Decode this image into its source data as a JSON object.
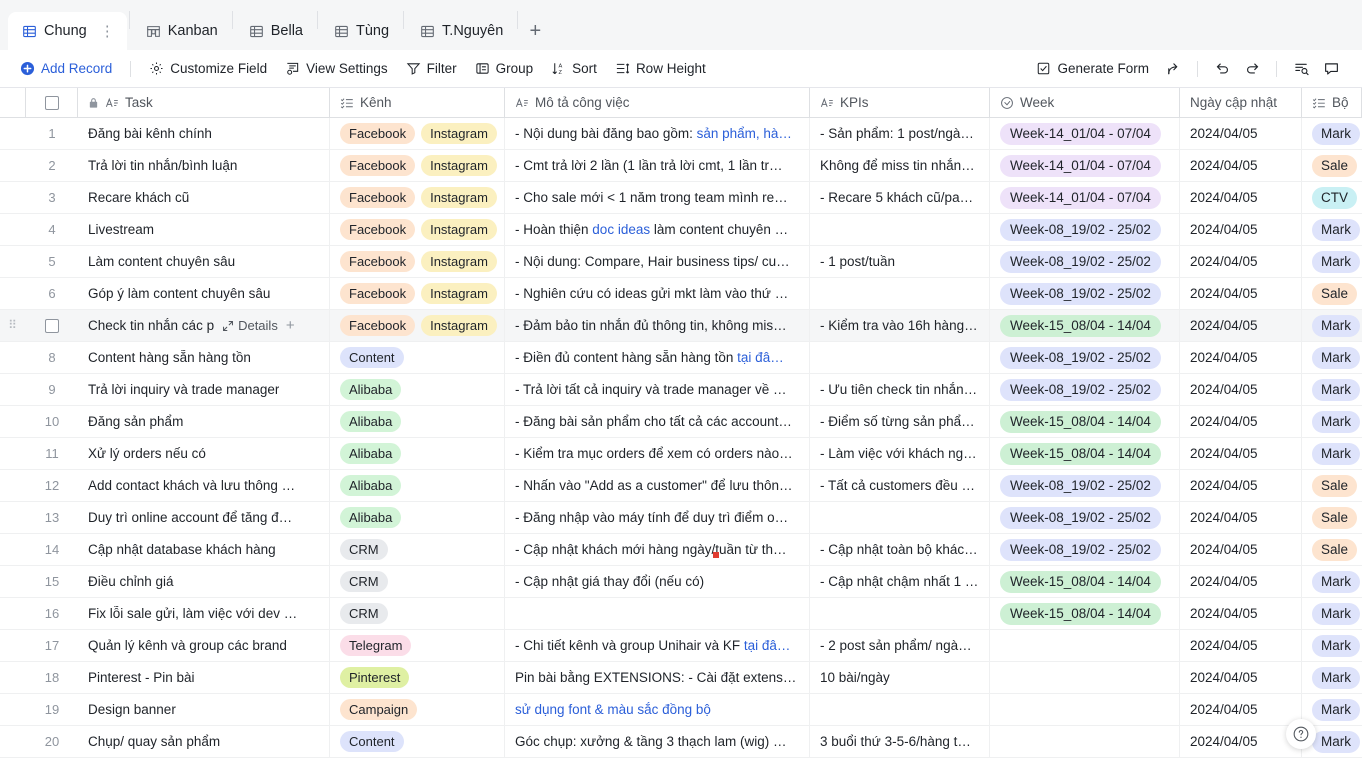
{
  "tabs": [
    {
      "label": "Chung",
      "icon": "grid-icon",
      "active": true
    },
    {
      "label": "Kanban",
      "icon": "kanban-icon",
      "active": false
    },
    {
      "label": "Bella",
      "icon": "grid-icon",
      "active": false
    },
    {
      "label": "Tùng",
      "icon": "grid-icon",
      "active": false
    },
    {
      "label": "T.Nguyên",
      "icon": "grid-icon",
      "active": false
    }
  ],
  "tab_add_label": "+",
  "tab_more_label": "⋮",
  "toolbar": {
    "add_record": "Add Record",
    "customize_field": "Customize Field",
    "view_settings": "View Settings",
    "filter": "Filter",
    "group": "Group",
    "sort": "Sort",
    "row_height": "Row Height",
    "generate_form": "Generate Form",
    "share_icon": "share-icon",
    "undo_icon": "undo-icon",
    "redo_icon": "redo-icon",
    "search_icon": "search-records-icon",
    "comment_icon": "comment-icon"
  },
  "columns": [
    {
      "key": "task",
      "label": "Task",
      "icon": "text-field-icon",
      "locked": true
    },
    {
      "key": "kenh",
      "label": "Kênh",
      "icon": "multi-select-icon"
    },
    {
      "key": "mota",
      "label": "Mô tả công việc",
      "icon": "text-field-icon"
    },
    {
      "key": "kpi",
      "label": "KPIs",
      "icon": "text-field-icon"
    },
    {
      "key": "week",
      "label": "Week",
      "icon": "single-select-icon"
    },
    {
      "key": "ngay",
      "label": "Ngày cập nhật",
      "icon": ""
    },
    {
      "key": "bo",
      "label": "Bộ",
      "icon": "multi-select-icon"
    }
  ],
  "help_label": "?",
  "rows": [
    {
      "num": "1",
      "task": "Đăng bài kênh chính",
      "kenh": [
        {
          "text": "Facebook",
          "style": "fb"
        },
        {
          "text": "Instagram",
          "style": "ig"
        }
      ],
      "mota_plain": "- Nội dung bài đăng bao gồm: ",
      "mota_link": "sản phẩm, hà…",
      "kpi": "- Sản phẩm: 1 post/ngà…",
      "week": "Week-14_01/04 - 07/04",
      "week_style": "purple",
      "ngay": "2024/04/05",
      "bo": "Mark",
      "bo_style": "mark"
    },
    {
      "num": "2",
      "task": "Trả lời tin nhắn/bình luận",
      "kenh": [
        {
          "text": "Facebook",
          "style": "fb"
        },
        {
          "text": "Instagram",
          "style": "ig"
        }
      ],
      "mota_plain": "- Cmt trả lời 2 lần (1 lần trả lời cmt, 1 lần tr…",
      "mota_link": "",
      "kpi": "Không để miss tin nhắn…",
      "week": "Week-14_01/04 - 07/04",
      "week_style": "purple",
      "ngay": "2024/04/05",
      "bo": "Sale",
      "bo_style": "sale"
    },
    {
      "num": "3",
      "task": "Recare khách cũ",
      "kenh": [
        {
          "text": "Facebook",
          "style": "fb"
        },
        {
          "text": "Instagram",
          "style": "ig"
        }
      ],
      "mota_plain": "- Cho sale mới < 1 năm trong team mình re…",
      "mota_link": "",
      "kpi": "- Recare 5 khách cũ/pag…",
      "week": "Week-14_01/04 - 07/04",
      "week_style": "purple",
      "ngay": "2024/04/05",
      "bo": "CTV",
      "bo_style": "ctv"
    },
    {
      "num": "4",
      "task": "Livestream",
      "kenh": [
        {
          "text": "Facebook",
          "style": "fb"
        },
        {
          "text": "Instagram",
          "style": "ig"
        }
      ],
      "mota_plain": "- Hoàn thiện ",
      "mota_link": "doc ideas",
      "mota_tail": " làm content chuyên …",
      "kpi": "",
      "week": "Week-08_19/02 - 25/02",
      "week_style": "blue",
      "ngay": "2024/04/05",
      "bo": "Mark",
      "bo_style": "mark"
    },
    {
      "num": "5",
      "task": "Làm content chuyên sâu",
      "kenh": [
        {
          "text": "Facebook",
          "style": "fb"
        },
        {
          "text": "Instagram",
          "style": "ig"
        }
      ],
      "mota_plain": "- Nội dung: Compare, Hair business tips/ cu…",
      "mota_link": "",
      "kpi": "- 1 post/tuần",
      "week": "Week-08_19/02 - 25/02",
      "week_style": "blue",
      "ngay": "2024/04/05",
      "bo": "Mark",
      "bo_style": "mark"
    },
    {
      "num": "6",
      "task": "Góp ý làm content chuyên sâu",
      "kenh": [
        {
          "text": "Facebook",
          "style": "fb"
        },
        {
          "text": "Instagram",
          "style": "ig"
        }
      ],
      "mota_plain": "- Nghiên cứu có ideas gửi mkt làm vào thứ …",
      "mota_link": "",
      "kpi": "",
      "week": "Week-08_19/02 - 25/02",
      "week_style": "blue",
      "ngay": "2024/04/05",
      "bo": "Sale",
      "bo_style": "sale"
    },
    {
      "num": "7",
      "task": "Check tin nhắn các p",
      "hovered": true,
      "details_label": "Details",
      "expand_icon": "expand-icon",
      "add_icon": "plus-icon",
      "kenh": [
        {
          "text": "Facebook",
          "style": "fb"
        },
        {
          "text": "Instagram",
          "style": "ig"
        }
      ],
      "mota_plain": "- Đảm bảo tin nhắn đủ thông tin, không mis…",
      "mota_link": "",
      "kpi": "- Kiểm tra vào 16h hàng…",
      "week": "Week-15_08/04 - 14/04",
      "week_style": "green",
      "ngay": "2024/04/05",
      "bo": "Mark",
      "bo_style": "mark"
    },
    {
      "num": "8",
      "task": "Content hàng sẵn hàng tồn",
      "kenh": [
        {
          "text": "Content",
          "style": "cont"
        }
      ],
      "mota_plain": "- Điền đủ content hàng sẵn hàng tồn ",
      "mota_link": "tại đâ…",
      "kpi": "",
      "week": "Week-08_19/02 - 25/02",
      "week_style": "blue",
      "ngay": "2024/04/05",
      "bo": "Mark",
      "bo_style": "mark"
    },
    {
      "num": "9",
      "task": "Trả lời inquiry và trade manager",
      "kenh": [
        {
          "text": "Alibaba",
          "style": "ali"
        }
      ],
      "mota_plain": "- Trả lời tất cả inquiry và trade manager về …",
      "mota_link": "",
      "kpi": "- Ưu tiên check tin nhắn…",
      "week": "Week-08_19/02 - 25/02",
      "week_style": "blue",
      "ngay": "2024/04/05",
      "bo": "Mark",
      "bo_style": "mark"
    },
    {
      "num": "10",
      "task": "Đăng sản phẩm",
      "kenh": [
        {
          "text": "Alibaba",
          "style": "ali"
        }
      ],
      "mota_plain": "- Đăng bài sản phẩm cho tất cả các account…",
      "mota_link": "",
      "kpi": "- Điểm số từng sản phẩ…",
      "week": "Week-15_08/04 - 14/04",
      "week_style": "green",
      "ngay": "2024/04/05",
      "bo": "Mark",
      "bo_style": "mark"
    },
    {
      "num": "11",
      "task": "Xử lý orders nếu có",
      "kenh": [
        {
          "text": "Alibaba",
          "style": "ali"
        }
      ],
      "mota_plain": "- Kiểm tra mục orders để xem có orders nào…",
      "mota_link": "",
      "kpi": "- Làm việc với khách ng…",
      "week": "Week-15_08/04 - 14/04",
      "week_style": "green",
      "ngay": "2024/04/05",
      "bo": "Mark",
      "bo_style": "mark"
    },
    {
      "num": "12",
      "task": "Add contact khách và lưu thông …",
      "kenh": [
        {
          "text": "Alibaba",
          "style": "ali"
        }
      ],
      "mota_plain": "- Nhấn vào \"Add as a customer\" để lưu thôn…",
      "mota_link": "",
      "kpi": "- Tất cả customers đều …",
      "week": "Week-08_19/02 - 25/02",
      "week_style": "blue",
      "ngay": "2024/04/05",
      "bo": "Sale",
      "bo_style": "sale"
    },
    {
      "num": "13",
      "task": "Duy trì online account để tăng đ…",
      "kenh": [
        {
          "text": "Alibaba",
          "style": "ali"
        }
      ],
      "mota_plain": "- Đăng nhập vào máy tính để duy trì điểm o…",
      "mota_link": "",
      "kpi": "",
      "week": "Week-08_19/02 - 25/02",
      "week_style": "blue",
      "ngay": "2024/04/05",
      "bo": "Sale",
      "bo_style": "sale"
    },
    {
      "num": "14",
      "task": "Cập nhật database khách hàng",
      "kenh": [
        {
          "text": "CRM",
          "style": "crm"
        }
      ],
      "mota_plain": "- Cập nhật khách mới hàng ngày/tuần từ th…",
      "mota_link": "",
      "kpi": "- Cập nhật toàn bộ khác…",
      "week": "Week-08_19/02 - 25/02",
      "week_style": "blue",
      "ngay": "2024/04/05",
      "bo": "Sale",
      "bo_style": "sale"
    },
    {
      "num": "15",
      "task": "Điều chỉnh giá",
      "kenh": [
        {
          "text": "CRM",
          "style": "crm"
        }
      ],
      "mota_plain": "- Cập nhật giá thay đổi (nếu có)",
      "mota_link": "",
      "kpi": "- Cập nhật chậm nhất 1 …",
      "week": "Week-15_08/04 - 14/04",
      "week_style": "green",
      "ngay": "2024/04/05",
      "bo": "Mark",
      "bo_style": "mark"
    },
    {
      "num": "16",
      "task": "Fix lỗi sale gửi, làm việc với dev …",
      "kenh": [
        {
          "text": "CRM",
          "style": "crm"
        }
      ],
      "mota_plain": "",
      "mota_link": "",
      "kpi": "",
      "week": "Week-15_08/04 - 14/04",
      "week_style": "green",
      "ngay": "2024/04/05",
      "bo": "Mark",
      "bo_style": "mark"
    },
    {
      "num": "17",
      "task": "Quản lý kênh và group các brand",
      "kenh": [
        {
          "text": "Telegram",
          "style": "tele"
        }
      ],
      "mota_plain": "- Chi tiết kênh và group Unihair và KF ",
      "mota_link": "tại đâ…",
      "kpi": "- 2 post sản phẩm/ ngà…",
      "week": "",
      "week_style": "none",
      "ngay": "2024/04/05",
      "bo": "Mark",
      "bo_style": "mark"
    },
    {
      "num": "18",
      "task": "Pinterest - Pin bài",
      "kenh": [
        {
          "text": "Pinterest",
          "style": "pin"
        }
      ],
      "mota_plain": "Pin bài bằng EXTENSIONS: - Cài đặt extensi…",
      "mota_link": "",
      "kpi": "10 bài/ngày",
      "week": "",
      "week_style": "none",
      "ngay": "2024/04/05",
      "bo": "Mark",
      "bo_style": "mark"
    },
    {
      "num": "19",
      "task": "Design banner",
      "kenh": [
        {
          "text": "Campaign",
          "style": "camp"
        }
      ],
      "mota_plain": "",
      "mota_link": "sử dụng font & màu sắc đồng bộ",
      "kpi": "",
      "week": "",
      "week_style": "none",
      "ngay": "2024/04/05",
      "bo": "Mark",
      "bo_style": "mark"
    },
    {
      "num": "20",
      "task": "Chụp/ quay sản phẩm",
      "kenh": [
        {
          "text": "Content",
          "style": "cont"
        }
      ],
      "mota_plain": "Góc chụp: xưởng & tầng 3 thạch lam (wig) …",
      "mota_link": "",
      "kpi": "3 buổi thứ 3-5-6/hàng t…",
      "week": "",
      "week_style": "none",
      "ngay": "2024/04/05",
      "bo": "Mark",
      "bo_style": "mark"
    }
  ]
}
